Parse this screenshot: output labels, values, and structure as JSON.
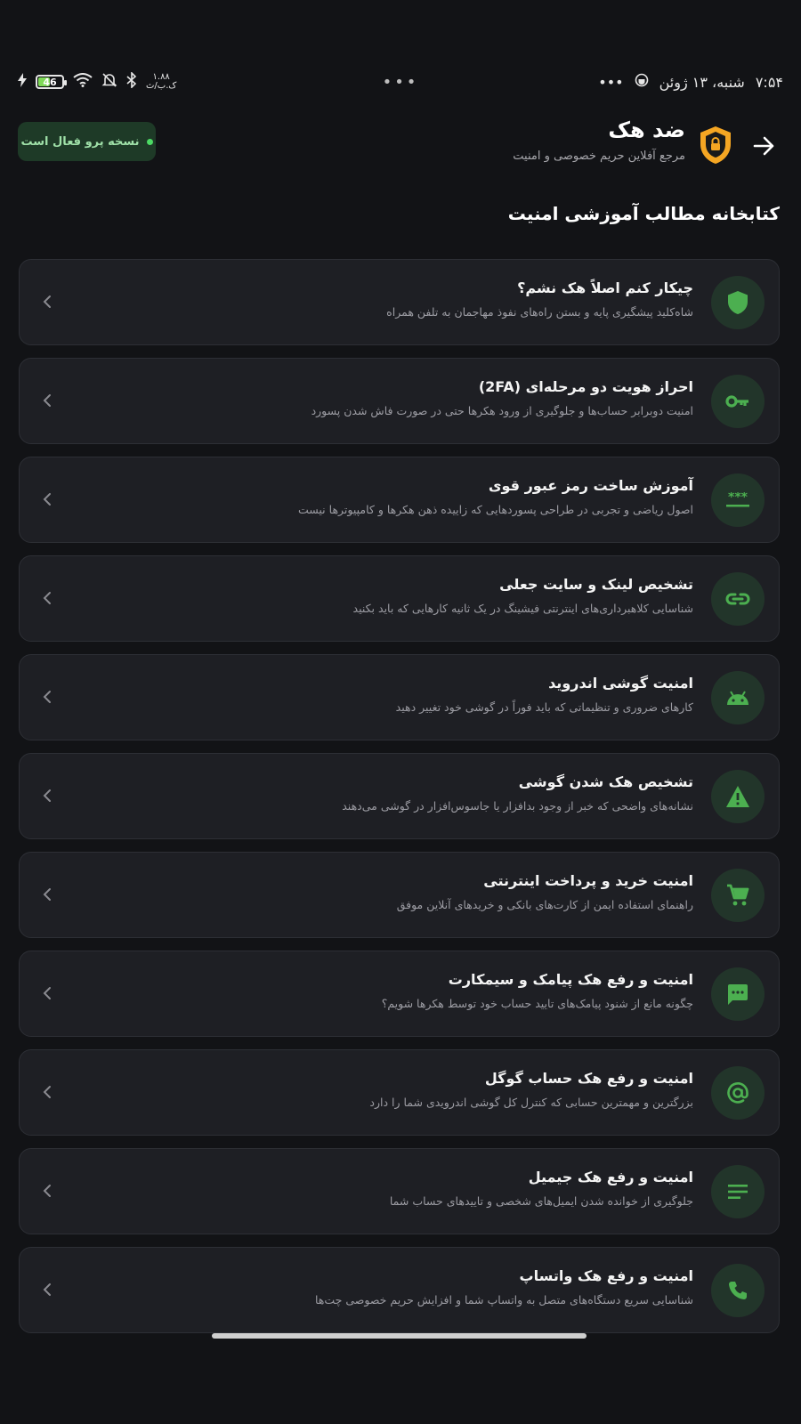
{
  "status_bar": {
    "time": "۷:۵۴",
    "date": "شنبه، ۱۳ ژوئن",
    "more": "•••",
    "battery": "46",
    "speed_value": "۱.۸۸",
    "speed_unit": "ک.ب/ث",
    "center_dots": "•••"
  },
  "header": {
    "title": "ضد هک",
    "subtitle": "مرجع آفلاین حریم خصوصی و امنیت",
    "pro_badge": "نسخه پرو فعال است"
  },
  "section_title": "کتابخانه مطالب آموزشی امنیت",
  "articles": [
    {
      "title": "چیکار کنم اصلاً هک نشم؟",
      "desc": "شاه‌کلید پیشگیری پایه و بستن راه‌های نفوذ مهاجمان به تلفن همراه",
      "icon": "shield-icon"
    },
    {
      "title": "احراز هویت دو مرحله‌ای (2FA)",
      "desc": "امنیت دوبرابر حساب‌ها و جلوگیری از ورود هکرها حتی در صورت فاش شدن پسورد",
      "icon": "key-icon"
    },
    {
      "title": "آموزش ساخت رمز عبور قوی",
      "desc": "اصول ریاضی و تجربی در طراحی پسوردهایی که زاییده ذهن هکرها و کامپیوترها نیست",
      "icon": "password-icon"
    },
    {
      "title": "تشخیص لینک و سایت جعلی",
      "desc": "شناسایی کلاهبرداری‌های اینترنتی فیشینگ در یک ثانیه کارهایی که باید بکنید",
      "icon": "link-icon"
    },
    {
      "title": "امنیت گوشی اندروید",
      "desc": "کارهای ضروری و تنظیماتی که باید فوراً در گوشی خود تغییر دهید",
      "icon": "android-icon"
    },
    {
      "title": "تشخیص هک شدن گوشی",
      "desc": "نشانه‌های واضحی که خبر از وجود بدافزار یا جاسوس‌افزار در گوشی می‌دهند",
      "icon": "warning-icon"
    },
    {
      "title": "امنیت خرید و پرداخت اینترنتی",
      "desc": "راهنمای استفاده ایمن از کارت‌های بانکی و خریدهای آنلاین موفق",
      "icon": "cart-icon"
    },
    {
      "title": "امنیت و رفع هک پیامک و سیمکارت",
      "desc": "چگونه مانع از شنود پیامک‌های تایید حساب خود توسط هکرها شویم؟",
      "icon": "message-icon"
    },
    {
      "title": "امنیت و رفع هک حساب گوگل",
      "desc": "بزرگترین و مهمترین حسابی که کنترل کل گوشی اندرویدی شما را دارد",
      "icon": "at-icon"
    },
    {
      "title": "امنیت و رفع هک جیمیل",
      "desc": "جلوگیری از خوانده شدن ایمیل‌های شخصی و تاییدهای حساب شما",
      "icon": "notes-icon"
    },
    {
      "title": "امنیت و رفع هک واتساپ",
      "desc": "شناسایی سریع دستگاه‌های متصل به واتساپ شما و افزایش حریم خصوصی چت‌ها",
      "icon": "phone-icon"
    }
  ],
  "colors": {
    "background": "#121316",
    "card": "#1e1f24",
    "accent_green": "#4caf50",
    "logo_orange": "#f5a623"
  }
}
